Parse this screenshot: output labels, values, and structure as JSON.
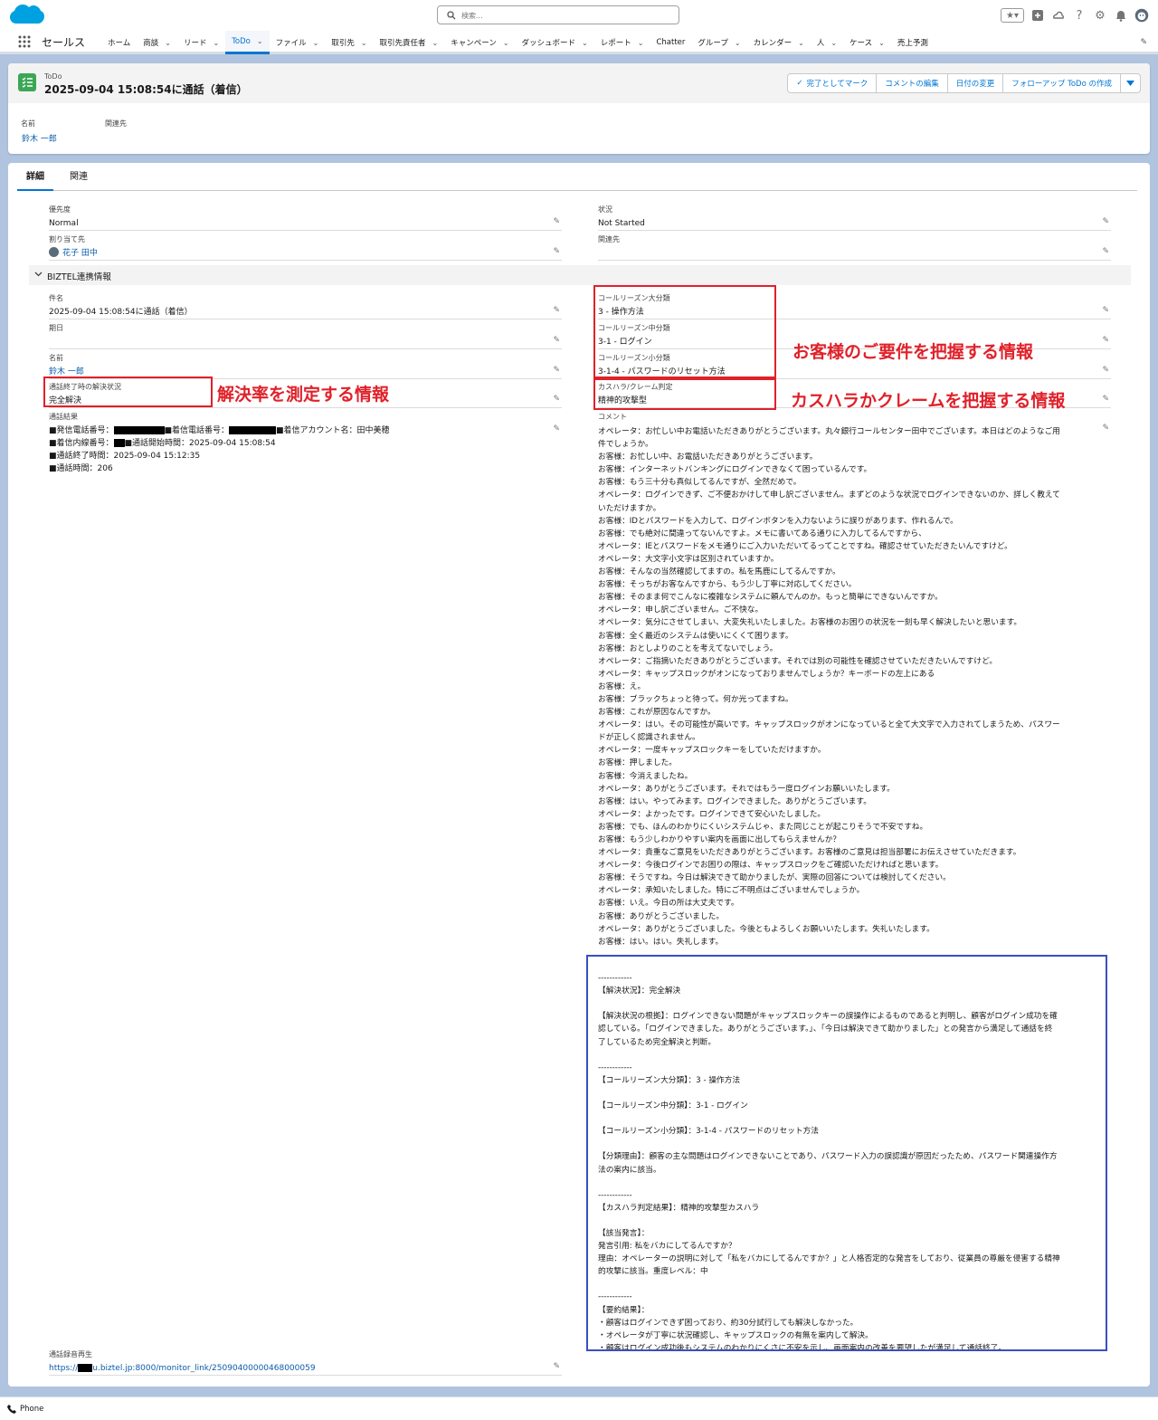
{
  "search": {
    "placeholder": "検索..."
  },
  "nav": {
    "app_name": "セールス",
    "items": [
      {
        "label": "ホーム",
        "chevron": false,
        "active": false
      },
      {
        "label": "商談",
        "chevron": true,
        "active": false
      },
      {
        "label": "リード",
        "chevron": true,
        "active": false
      },
      {
        "label": "ToDo",
        "chevron": true,
        "active": true
      },
      {
        "label": "ファイル",
        "chevron": true,
        "active": false
      },
      {
        "label": "取引先",
        "chevron": true,
        "active": false
      },
      {
        "label": "取引先責任者",
        "chevron": true,
        "active": false
      },
      {
        "label": "キャンペーン",
        "chevron": true,
        "active": false
      },
      {
        "label": "ダッシュボード",
        "chevron": true,
        "active": false
      },
      {
        "label": "レポート",
        "chevron": true,
        "active": false
      },
      {
        "label": "Chatter",
        "chevron": false,
        "active": false
      },
      {
        "label": "グループ",
        "chevron": true,
        "active": false
      },
      {
        "label": "カレンダー",
        "chevron": true,
        "active": false
      },
      {
        "label": "人",
        "chevron": true,
        "active": false
      },
      {
        "label": "ケース",
        "chevron": true,
        "active": false
      },
      {
        "label": "売上予測",
        "chevron": false,
        "active": false
      }
    ]
  },
  "record": {
    "object_label": "ToDo",
    "title": "2025-09-04 15:08:54に通話（着信）",
    "buttons": {
      "mark_complete": "完了としてマーク",
      "edit_comment": "コメントの編集",
      "change_date": "日付の変更",
      "create_followup": "フォローアップ ToDo の作成"
    },
    "highlights": {
      "name_label": "名前",
      "name_value": "鈴木 一郎",
      "related_label": "関連先"
    }
  },
  "tabs": {
    "detail": "詳細",
    "related": "関連"
  },
  "fields": {
    "priority_label": "優先度",
    "priority_value": "Normal",
    "status_label": "状況",
    "status_value": "Not Started",
    "assigned_label": "割り当て先",
    "assigned_value": "花子 田中",
    "related_label": "関連先",
    "section_title": "BIZTEL連携情報",
    "subject_label": "件名",
    "subject_value": "2025-09-04 15:08:54に通話（着信）",
    "due_label": "期日",
    "name_label": "名前",
    "name_value": "鈴木 一郎",
    "resolution_label": "通話終了時の解決状況",
    "resolution_value": "完全解決",
    "result_label": "通話結果",
    "result_line1_a": "■発信電話番号：",
    "result_line1_b": "■着信電話番号：",
    "result_line1_c": "■着信アカウント名：田中美穂",
    "result_line2_a": "■着信内線番号：",
    "result_line2_b": "■通話開始時間：2025-09-04 15:08:54",
    "result_line3": "■通話終了時間：2025-09-04 15:12:35",
    "result_line4": "■通話時間：206",
    "reason_major_label": "コールリーズン大分類",
    "reason_major_value": "3 - 操作方法",
    "reason_mid_label": "コールリーズン中分類",
    "reason_mid_value": "3-1 - ログイン",
    "reason_minor_label": "コールリーズン小分類",
    "reason_minor_value": "3-1-4 - パスワードのリセット方法",
    "harassment_label": "カスハラ/クレーム判定",
    "harassment_value": "精神的攻撃型",
    "comment_label": "コメント",
    "recording_label": "通話録音再生",
    "recording_prefix": "https://",
    "recording_suffix": "u.biztel.jp:8000/monitor_link/25090400000468000059"
  },
  "comment_lines": [
    "オペレータ：お忙しい中お電話いただきありがとうございます。丸々銀行コールセンター田中でございます。本日はどのようなご用",
    "件でしょうか。",
    "お客様：お忙しい中、お電話いただきありがとうございます。",
    "お客様：インターネットバンキングにログインできなくて困っているんです。",
    "お客様：もう三十分も真似してるんですが、全然だめで。",
    "オペレータ：ログインできず、ご不便おかけして申し訳ございません。まずどのような状況でログインできないのか、詳しく教えて",
    "いただけますか。",
    "お客様：IDとパスワードを入力して、ログインボタンを入力ないように誤りがあります、作れるんで。",
    "お客様：でも絶対に間違ってないんですよ。メモに書いてある通りに入力してるんですから、",
    "オペレータ：IEとパスワードをメモ通りにご入力いただいてるってことですね。確認させていただきたいんですけど。",
    "オペレータ：大文字小文字は区別されていますか。",
    "お客様：そんなの当然確認してますの。私を馬鹿にしてるんですか。",
    "お客様：そっちがお客なんですから、もう少し丁寧に対応してください。",
    "お客様：そのまま何でこんなに複雑なシステムに頼んでんのか。もっと簡単にできないんですか。",
    "オペレータ：申し訳ございません。ご不快な。",
    "オペレータ：気分にさせてしまい、大変失礼いたしました。お客様のお困りの状況を一刻も早く解決したいと思います。",
    "お客様：全く最近のシステムは使いにくくて困ります。",
    "お客様：おとしよりのことを考えてないでしょう。",
    "オペレータ：ご指摘いただきありがとうございます。それでは別の可能性を確認させていただきたいんですけど。",
    "オペレータ：キャップスロックがオンになっておりませんでしょうか？キーボードの左上にある",
    "お客様：え。",
    "お客様：ブラックちょっと待って。何か光ってますね。",
    "お客様：これが原因なんですか。",
    "オペレータ：はい。その可能性が高いです。キャップスロックがオンになっていると全て大文字で入力されてしまうため、パスワー",
    "ドが正しく認識されません。",
    "オペレータ：一度キャップスロックキーをしていただけますか。",
    "お客様：押しました。",
    "お客様：今消えましたね。",
    "オペレータ：ありがとうございます。それではもう一度ログインお願いいたします。",
    "お客様：はい。やってみます。ログインできました。ありがとうございます。",
    "オペレータ：よかったです。ログインできて安心いたしました。",
    "お客様：でも、ほんのわかりにくいシステムじゃ、また同じことが起こりそうで不安ですね。",
    "お客様：もう少しわかりやすい案内を画面に出してもらえませんか？",
    "オペレータ：貴重なご意見をいただきありがとうございます。お客様のご意見は担当部署にお伝えさせていただきます。",
    "オペレータ：今後ログインでお困りの際は、キャップスロックをご確認いただければと思います。",
    "お客様：そうですね。今日は解決できて助かりましたが、実際の回答については検討してください。",
    "オペレータ：承知いたしました。特にご不明点はございませんでしょうか。",
    "お客様：いえ。今日の所は大丈夫です。",
    "お客様：ありがとうございました。",
    "オペレータ：ありがとうございました。今後ともよろしくお願いいたします。失礼いたします。",
    "お客様：はい。はい。失礼します。"
  ],
  "summary_lines": [
    "",
    "------------",
    "【解決状況】：完全解決",
    "",
    "【解決状況の根拠】：ログインできない問題がキャップスロックキーの誤操作によるものであると判明し、顧客がログイン成功を確",
    "認している。「ログインできました。ありがとうございます。」、「今日は解決できて助かりました」との発言から満足して通話を終",
    "了しているため完全解決と判断。",
    "",
    "------------",
    "【コールリーズン大分類】：3 - 操作方法",
    "",
    "【コールリーズン中分類】：3-1 - ログイン",
    "",
    "【コールリーズン小分類】：3-1-4 - パスワードのリセット方法",
    "",
    "【分類理由】：顧客の主な問題はログインできないことであり、パスワード入力の誤認識が原因だったため、パスワード関連操作方",
    "法の案内に該当。",
    "",
    "------------",
    "【カスハラ判定結果】：精神的攻撃型カスハラ",
    "",
    "【該当発言】：",
    "発言引用: 私をバカにしてるんですか？",
    "理由：オペレーターの説明に対して「私をバカにしてるんですか？」と人格否定的な発言をしており、従業員の尊厳を侵害する精神",
    "的攻撃に該当。重度レベル：中",
    "",
    "------------",
    "【要約結果】：",
    "・顧客はログインできず困っており、約30分試行しても解決しなかった。",
    "・オペレータが丁寧に状況確認し、キャップスロックの有無を案内して解決。",
    "・顧客はログイン成功後もシステムのわかりにくさに不安を示し、画面案内の改善を要望したが満足して通話終了。"
  ],
  "annotations": {
    "resolution": "解決率を測定する情報",
    "reason": "お客様のご要件を把握する情報",
    "harassment": "カスハラかクレームを把握する情報"
  },
  "utility": {
    "phone": "Phone"
  },
  "colors": {
    "brand": "#0176d3",
    "todo_icon": "#3ba755",
    "annotation_red": "#e0212a",
    "annotation_blue": "#3a4fc1"
  }
}
